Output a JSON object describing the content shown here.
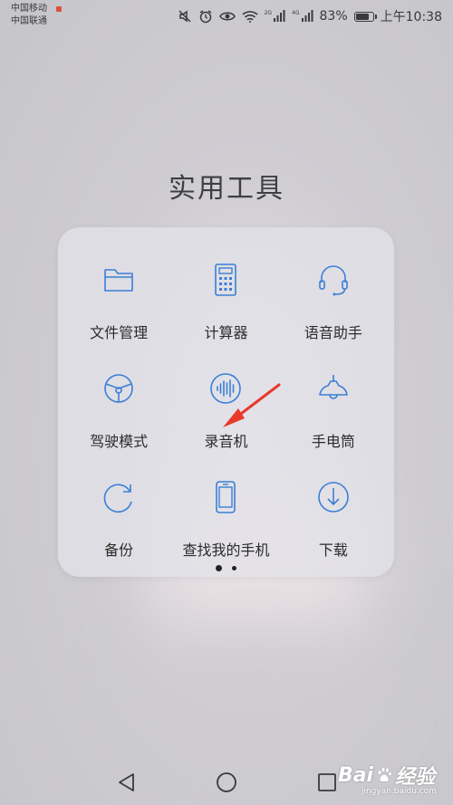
{
  "status_bar": {
    "carrier_1": "中国移动",
    "carrier_2": "中国联通",
    "network_badge_1": "2G",
    "network_badge_2": "4G",
    "battery": "83%",
    "time": "上午10:38"
  },
  "folder": {
    "title": "实用工具",
    "apps": [
      {
        "label": "文件管理",
        "icon": "folder-icon"
      },
      {
        "label": "计算器",
        "icon": "calculator-icon"
      },
      {
        "label": "语音助手",
        "icon": "headset-icon"
      },
      {
        "label": "驾驶模式",
        "icon": "steering-wheel-icon"
      },
      {
        "label": "录音机",
        "icon": "voice-recorder-icon"
      },
      {
        "label": "手电筒",
        "icon": "flashlight-lamp-icon"
      },
      {
        "label": "备份",
        "icon": "backup-icon"
      },
      {
        "label": "查找我的手机",
        "icon": "find-phone-icon"
      },
      {
        "label": "下载",
        "icon": "download-icon"
      }
    ],
    "pages": 2,
    "current_page": 1
  },
  "annotation": {
    "color": "#e8392b",
    "target": "录音机"
  },
  "watermark": {
    "logo_text": "Bai",
    "logo_text_2": "经验",
    "sub_text": "jingyan.baidu.com"
  },
  "colors": {
    "icon_blue": "#3b7fd6",
    "label_text": "#2c2c2c"
  }
}
